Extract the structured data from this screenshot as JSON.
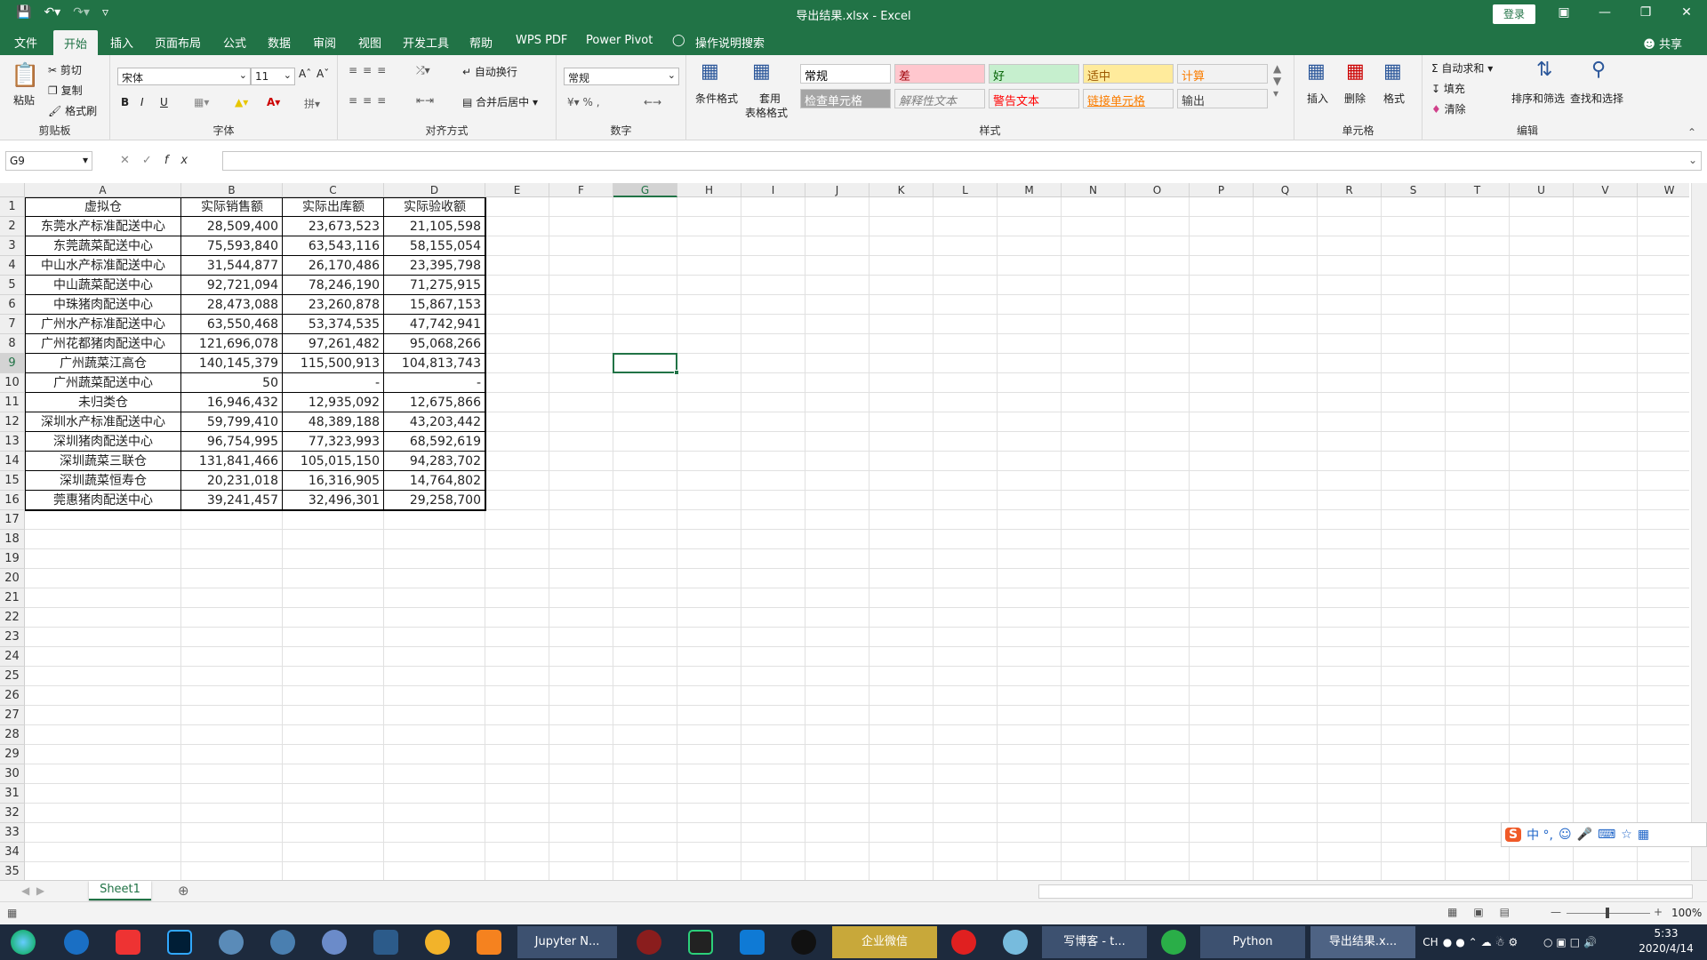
{
  "window": {
    "title": "导出结果.xlsx  -  Excel",
    "login": "登录"
  },
  "tabs": [
    "文件",
    "开始",
    "插入",
    "页面布局",
    "公式",
    "数据",
    "审阅",
    "视图",
    "开发工具",
    "帮助",
    "WPS PDF",
    "Power Pivot",
    "操作说明搜索"
  ],
  "share": "共享",
  "ribbon": {
    "clipboard": {
      "label": "剪贴板",
      "paste": "粘贴",
      "cut": "剪切",
      "copy": "复制",
      "painter": "格式刷"
    },
    "font": {
      "label": "字体",
      "name": "宋体",
      "size": "11",
      "bold": "B",
      "italic": "I",
      "underline": "U"
    },
    "align": {
      "label": "对齐方式",
      "wrap": "自动换行",
      "merge": "合并后居中"
    },
    "number": {
      "label": "数字",
      "format": "常规"
    },
    "styles": {
      "label": "样式",
      "cond": "条件格式",
      "table1": "套用",
      "table2": "表格格式",
      "items": [
        {
          "t": "常规",
          "bg": "#ffffff",
          "c": "#000000"
        },
        {
          "t": "差",
          "bg": "#ffc7ce",
          "c": "#9c0006"
        },
        {
          "t": "好",
          "bg": "#c6efce",
          "c": "#006100"
        },
        {
          "t": "适中",
          "bg": "#ffeb9c",
          "c": "#9c5700"
        },
        {
          "t": "计算",
          "bg": "#f2f2f2",
          "c": "#fa7d00"
        },
        {
          "t": "检查单元格",
          "bg": "#a5a5a5",
          "c": "#ffffff"
        },
        {
          "t": "解释性文本",
          "bg": "#f3f3f3",
          "c": "#7f7f7f"
        },
        {
          "t": "警告文本",
          "bg": "#f3f3f3",
          "c": "#ff0000"
        },
        {
          "t": "链接单元格",
          "bg": "#f3f3f3",
          "c": "#fa7d00"
        },
        {
          "t": "输出",
          "bg": "#f2f2f2",
          "c": "#3f3f3f"
        }
      ]
    },
    "cells": {
      "label": "单元格",
      "insert": "插入",
      "delete": "删除",
      "format": "格式"
    },
    "editing": {
      "label": "编辑",
      "autosum": "自动求和",
      "fill": "填充",
      "clear": "清除",
      "sort": "排序和筛选",
      "find": "查找和选择"
    }
  },
  "formula": {
    "namebox": "G9",
    "fx": "fx"
  },
  "grid": {
    "columns": [
      "A",
      "B",
      "C",
      "D",
      "E",
      "F",
      "G",
      "H",
      "I",
      "J",
      "K",
      "L",
      "M",
      "N",
      "O",
      "P",
      "Q",
      "R",
      "S",
      "T",
      "U",
      "V",
      "W"
    ],
    "selected_col": "G",
    "selected_row": 9,
    "header": [
      "虚拟仓",
      "实际销售额",
      "实际出库额",
      "实际验收额"
    ],
    "rows": [
      [
        "东莞水产标准配送中心",
        "28,509,400",
        "23,673,523",
        "21,105,598"
      ],
      [
        "东莞蔬菜配送中心",
        "75,593,840",
        "63,543,116",
        "58,155,054"
      ],
      [
        "中山水产标准配送中心",
        "31,544,877",
        "26,170,486",
        "23,395,798"
      ],
      [
        "中山蔬菜配送中心",
        "92,721,094",
        "78,246,190",
        "71,275,915"
      ],
      [
        "中珠猪肉配送中心",
        "28,473,088",
        "23,260,878",
        "15,867,153"
      ],
      [
        "广州水产标准配送中心",
        "63,550,468",
        "53,374,535",
        "47,742,941"
      ],
      [
        "广州花都猪肉配送中心",
        "121,696,078",
        "97,261,482",
        "95,068,266"
      ],
      [
        "广州蔬菜江高仓",
        "140,145,379",
        "115,500,913",
        "104,813,743"
      ],
      [
        "广州蔬菜配送中心",
        "50",
        "-",
        "-"
      ],
      [
        "未归类仓",
        "16,946,432",
        "12,935,092",
        "12,675,866"
      ],
      [
        "深圳水产标准配送中心",
        "59,799,410",
        "48,389,188",
        "43,203,442"
      ],
      [
        "深圳猪肉配送中心",
        "96,754,995",
        "77,323,993",
        "68,592,619"
      ],
      [
        "深圳蔬菜三联仓",
        "131,841,466",
        "105,015,150",
        "94,283,702"
      ],
      [
        "深圳蔬菜恒寿仓",
        "20,231,018",
        "16,316,905",
        "14,764,802"
      ],
      [
        "莞惠猪肉配送中心",
        "39,241,457",
        "32,496,301",
        "29,258,700"
      ]
    ]
  },
  "sheet": {
    "name": "Sheet1",
    "zoom": "100%"
  },
  "taskbar": {
    "jupyter": "Jupyter N...",
    "wework": "企业微信",
    "chrome": "写博客 - t...",
    "python": "Python",
    "excel": "导出结果.x...",
    "lang": "CH",
    "time": "5:33",
    "date": "2020/4/14"
  },
  "ime": {
    "text": "中 °,"
  }
}
